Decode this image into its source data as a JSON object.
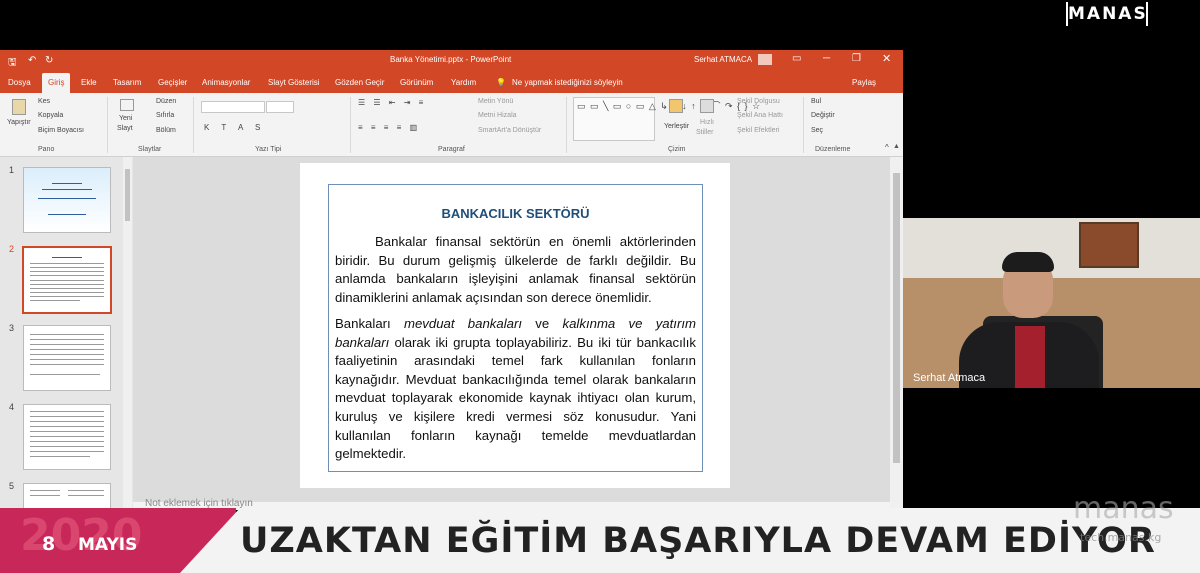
{
  "brand": {
    "logo_text": "MANAS",
    "watermark": "manas",
    "watermark_url": "tech.manas.kg"
  },
  "window": {
    "title": "Banka Yönetimi.pptx - PowerPoint",
    "user": "Serhat ATMACA",
    "share": "Paylaş"
  },
  "tabs": [
    "Dosya",
    "Giriş",
    "Ekle",
    "Tasarım",
    "Geçişler",
    "Animasyonlar",
    "Slayt Gösterisi",
    "Gözden Geçir",
    "Görünüm",
    "Yardım"
  ],
  "tell_me": "Ne yapmak istediğinizi söyleyin",
  "ribbon": {
    "clipboard": {
      "paste": "Yapıştır",
      "cut": "Kes",
      "copy": "Kopyala",
      "painter": "Biçim Boyacısı",
      "group": "Pano"
    },
    "slides": {
      "new": "Yeni",
      "new2": "Slayt",
      "layout": "Düzen",
      "reset": "Sıfırla",
      "section": "Bölüm",
      "group": "Slaytlar"
    },
    "font": {
      "group": "Yazı Tipi"
    },
    "paragraph": {
      "dir": "Metin Yönü",
      "align": "Metni Hizala",
      "smartart": "SmartArt'a Dönüştür",
      "group": "Paragraf"
    },
    "drawing": {
      "arrange": "Yerleştir",
      "quick": "Hızlı",
      "quick2": "Stiller",
      "fill": "Şekil Dolgusu",
      "outline": "Şekil Ana Hattı",
      "effects": "Şekil Efektleri",
      "group": "Çizim"
    },
    "editing": {
      "find": "Bul",
      "replace": "Değiştir",
      "select": "Seç",
      "group": "Düzenleme"
    }
  },
  "thumbs": [
    "1",
    "2",
    "3",
    "4",
    "5"
  ],
  "slide": {
    "title": "BANKACILIK SEKTÖRÜ",
    "p1": "Bankalar finansal sektörün en önemli aktörlerinden biridir. Bu durum gelişmiş ülkelerde de farklı değildir. Bu anlamda bankaların işleyişini anlamak finansal sektörün dinamiklerini anlamak açısından son derece önemlidir.",
    "p2a": "Bankaları ",
    "p2b": "mevduat bankaları",
    "p2c": " ve ",
    "p2d": "kalkınma ve yatırım bankaları",
    "p2e": " olarak iki grupta toplayabiliriz. Bu iki tür bankacılık faaliyetinin arasındaki temel fark kullanılan fonların kaynağıdır. Mevduat bankacılığında temel olarak bankaların mevduat toplayarak ekonomide kaynak ihtiyacı olan kurum, kuruluş ve kişilere kredi vermesi söz konusudur. Yani kullanılan fonların kaynağı temelde mevduatlardan gelmektedir."
  },
  "notes_placeholder": "Not eklemek için tıklayın",
  "webcam": {
    "name": "Serhat Atmaca"
  },
  "banner": {
    "year": "2020",
    "day": "8",
    "month": "MAYIS",
    "headline": "UZAKTAN EĞİTİM BAŞARIYLA DEVAM EDİYOR"
  }
}
